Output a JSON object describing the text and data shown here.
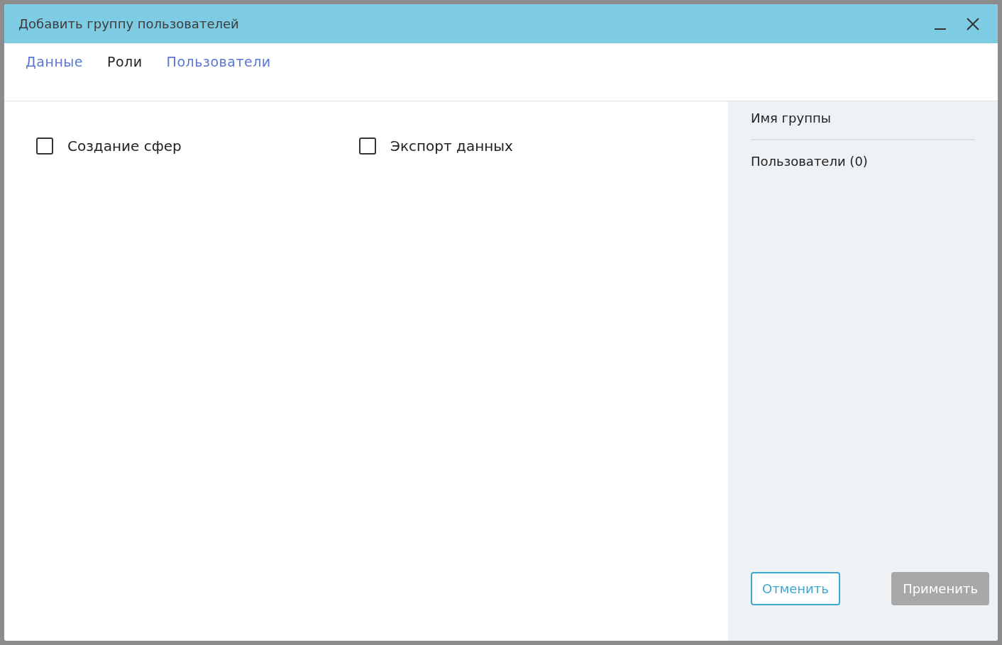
{
  "window": {
    "title": "Добавить группу пользователей"
  },
  "tabs": [
    {
      "label": "Данные",
      "selected": false
    },
    {
      "label": "Роли",
      "selected": true
    },
    {
      "label": "Пользователи",
      "selected": false
    }
  ],
  "permissions": [
    {
      "label": "Создание сфер",
      "checked": false
    },
    {
      "label": "Экспорт данных",
      "checked": false
    }
  ],
  "summary": {
    "group_name": "Имя группы",
    "users": "Пользователи (0)"
  },
  "buttons": [
    {
      "label": "Отменить",
      "kind": "outline",
      "disabled": false
    },
    {
      "label": "Применить",
      "kind": "primary",
      "disabled": true
    }
  ]
}
